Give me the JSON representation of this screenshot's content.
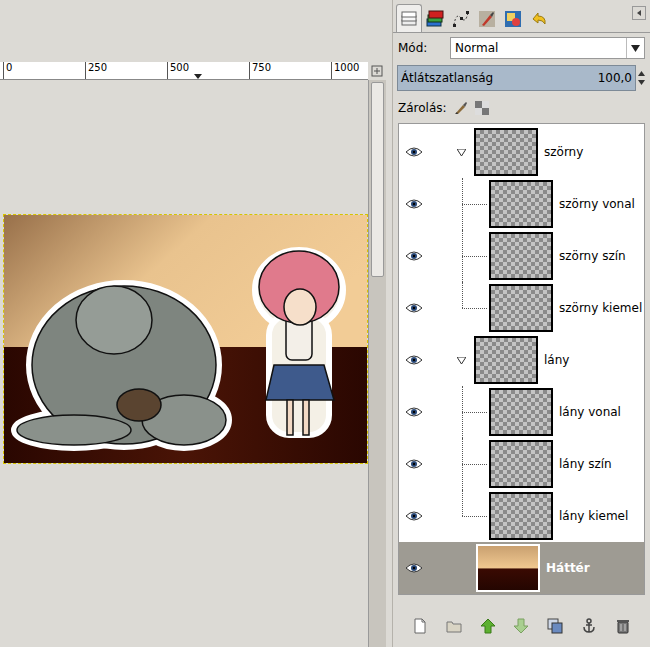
{
  "canvas": {
    "ruler_ticks": [
      "0",
      "250",
      "500",
      "750",
      "1000"
    ]
  },
  "tabs": [
    {
      "selected": true
    },
    {
      "selected": false
    },
    {
      "selected": false
    },
    {
      "selected": false
    },
    {
      "selected": false
    },
    {
      "selected": false
    }
  ],
  "mode": {
    "label": "Mód:",
    "value": "Normal"
  },
  "opacity": {
    "label": "Átlátszatlanság",
    "reading": "100,0",
    "level": 1
  },
  "lock": {
    "label": "Zárolás:"
  },
  "layers": [
    {
      "name": "szörny",
      "kind": "group",
      "expanded": true,
      "visible": true,
      "selected": false
    },
    {
      "name": "szörny vonal",
      "kind": "child",
      "expanded": false,
      "visible": true,
      "selected": false
    },
    {
      "name": "szörny szín",
      "kind": "child",
      "expanded": false,
      "visible": true,
      "selected": false
    },
    {
      "name": "szörny kiemel",
      "kind": "child",
      "expanded": false,
      "visible": true,
      "selected": false
    },
    {
      "name": "lány",
      "kind": "group",
      "expanded": true,
      "visible": true,
      "selected": false
    },
    {
      "name": "lány vonal",
      "kind": "child",
      "expanded": false,
      "visible": true,
      "selected": false
    },
    {
      "name": "lány szín",
      "kind": "child",
      "expanded": false,
      "visible": true,
      "selected": false
    },
    {
      "name": "lány kiemel",
      "kind": "child",
      "expanded": false,
      "visible": true,
      "selected": false
    },
    {
      "name": "Háttér",
      "kind": "background",
      "expanded": false,
      "visible": true,
      "selected": true
    }
  ]
}
